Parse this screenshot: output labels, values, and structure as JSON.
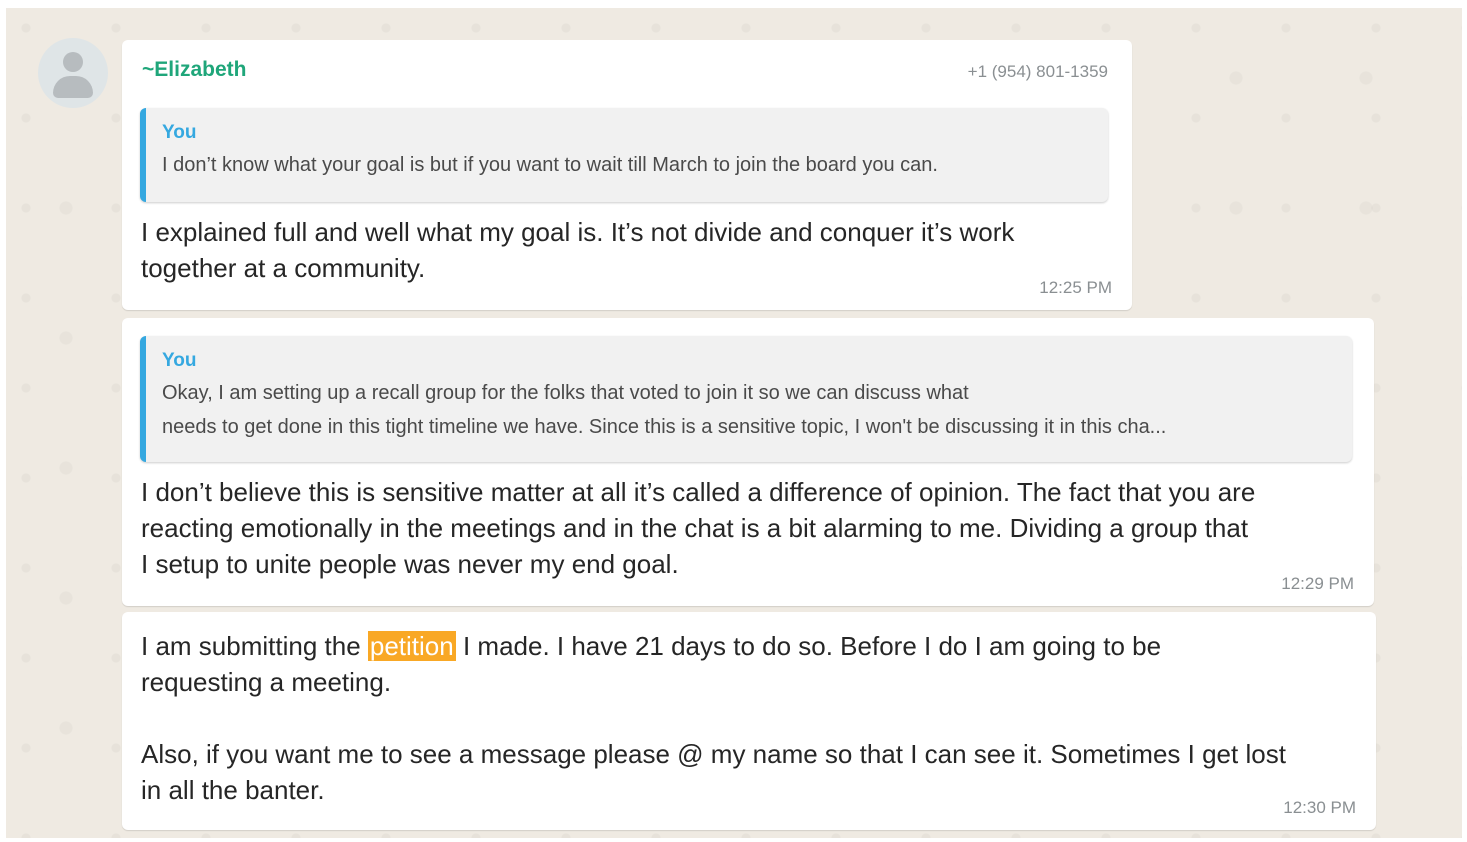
{
  "messages": [
    {
      "sender": "~Elizabeth",
      "phone": "+1 (954) 801-1359",
      "quote": {
        "author": "You",
        "text": "I don’t know what your goal is but if you want to wait till March to join the board you can."
      },
      "text": "I explained full and well what my goal is. It’s not divide and conquer it’s work\ntogether at a community.",
      "time": "12:25 PM"
    },
    {
      "quote": {
        "author": "You",
        "text": "Okay, I am setting up a recall group for the folks that voted to join it so we can discuss what\nneeds to get done in this tight timeline we have. Since this is a sensitive topic, I won't be discussing it in this cha..."
      },
      "text": "I don’t believe this is sensitive matter at all it’s called a difference of opinion. The fact that you are\nreacting emotionally in the meetings and in the chat is a bit alarming to me. Dividing a group that\nI setup to unite people was never my end goal.",
      "time": "12:29 PM"
    },
    {
      "text_before": "I am submitting the ",
      "highlight": "petition",
      "text_after": " I made. I have 21 days to do so. Before I do I am going to be\nrequesting a meeting.\n\nAlso, if you want me to see a message please @ my name so that I can see it. Sometimes I get lost\nin all the banter.",
      "time": "12:30 PM"
    }
  ],
  "avatar_icon": "default-user-icon",
  "colors": {
    "sender": "#1fa67a",
    "quote_accent": "#35a8e0",
    "search_highlight": "#f9a825",
    "chat_background": "#efeae2"
  }
}
